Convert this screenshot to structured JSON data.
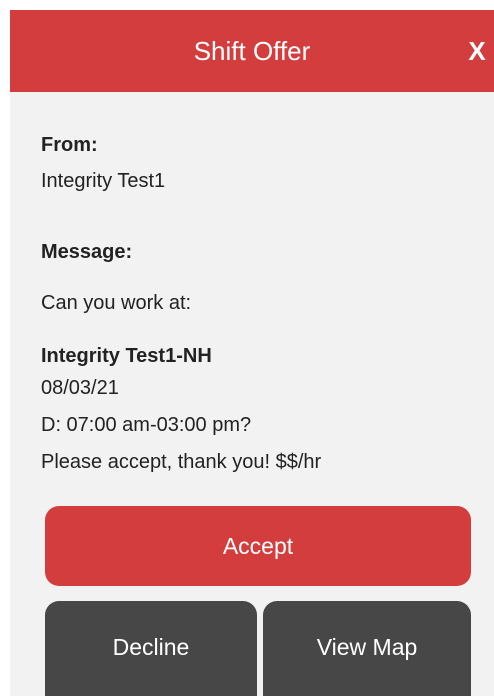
{
  "header": {
    "title": "Shift Offer",
    "close_label": "X"
  },
  "sender": {
    "label": "From:",
    "name": "Integrity Test1"
  },
  "message": {
    "label": "Message:",
    "intro": "Can you work at:",
    "facility": "Integrity Test1-NH",
    "date": "08/03/21",
    "shift": "D: 07:00 am-03:00 pm?",
    "closing": "Please accept, thank you! $$/hr"
  },
  "actions": {
    "accept": "Accept",
    "decline": "Decline",
    "view_map": "View Map"
  },
  "colors": {
    "accent": "#d43d3d",
    "secondary_button": "#474747",
    "background": "#f2f2f2"
  }
}
